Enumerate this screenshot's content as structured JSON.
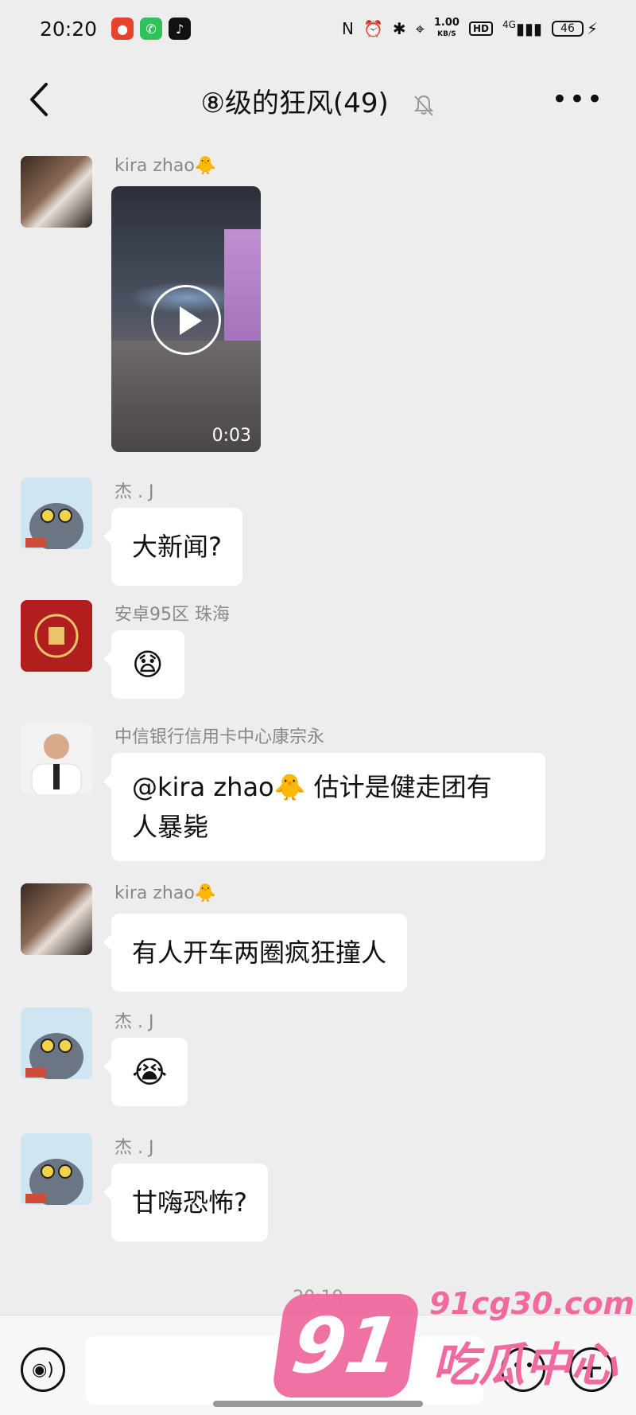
{
  "status_bar": {
    "time": "20:20",
    "net_speed_value": "1.00",
    "net_speed_unit": "KB/S",
    "hd": "HD",
    "signal": "4G",
    "battery": "46",
    "icons": [
      "nfc-icon",
      "alarm-icon",
      "bluetooth-icon",
      "location-icon",
      "signal-icon",
      "battery-icon",
      "charging-icon"
    ]
  },
  "header": {
    "title": "⑧级的狂风(49)",
    "muted": true
  },
  "messages": [
    {
      "sender": "kira zhao🐥",
      "type": "video",
      "duration": "0:03"
    },
    {
      "sender": "杰 . J",
      "type": "text",
      "text": "大新闻?"
    },
    {
      "sender": "安卓95区  珠海",
      "type": "emoji",
      "text": "😧"
    },
    {
      "sender": "中信银行信用卡中心康宗永",
      "type": "text",
      "line1": "@kira zhao🐥  估计是健走团有",
      "line2": "人暴毙"
    },
    {
      "sender": "kira zhao🐥",
      "type": "text",
      "text": "有人开车两圈疯狂撞人"
    },
    {
      "sender": "杰 . J",
      "type": "emoji",
      "text": "😭"
    },
    {
      "sender": "杰 . J",
      "type": "text",
      "text": "甘嗨恐怖?"
    }
  ],
  "timestamp": "20:19",
  "input_bar": {
    "placeholder": ""
  },
  "watermark": {
    "number": "91",
    "site": "91cg30.com",
    "name": "吃瓜中心"
  }
}
